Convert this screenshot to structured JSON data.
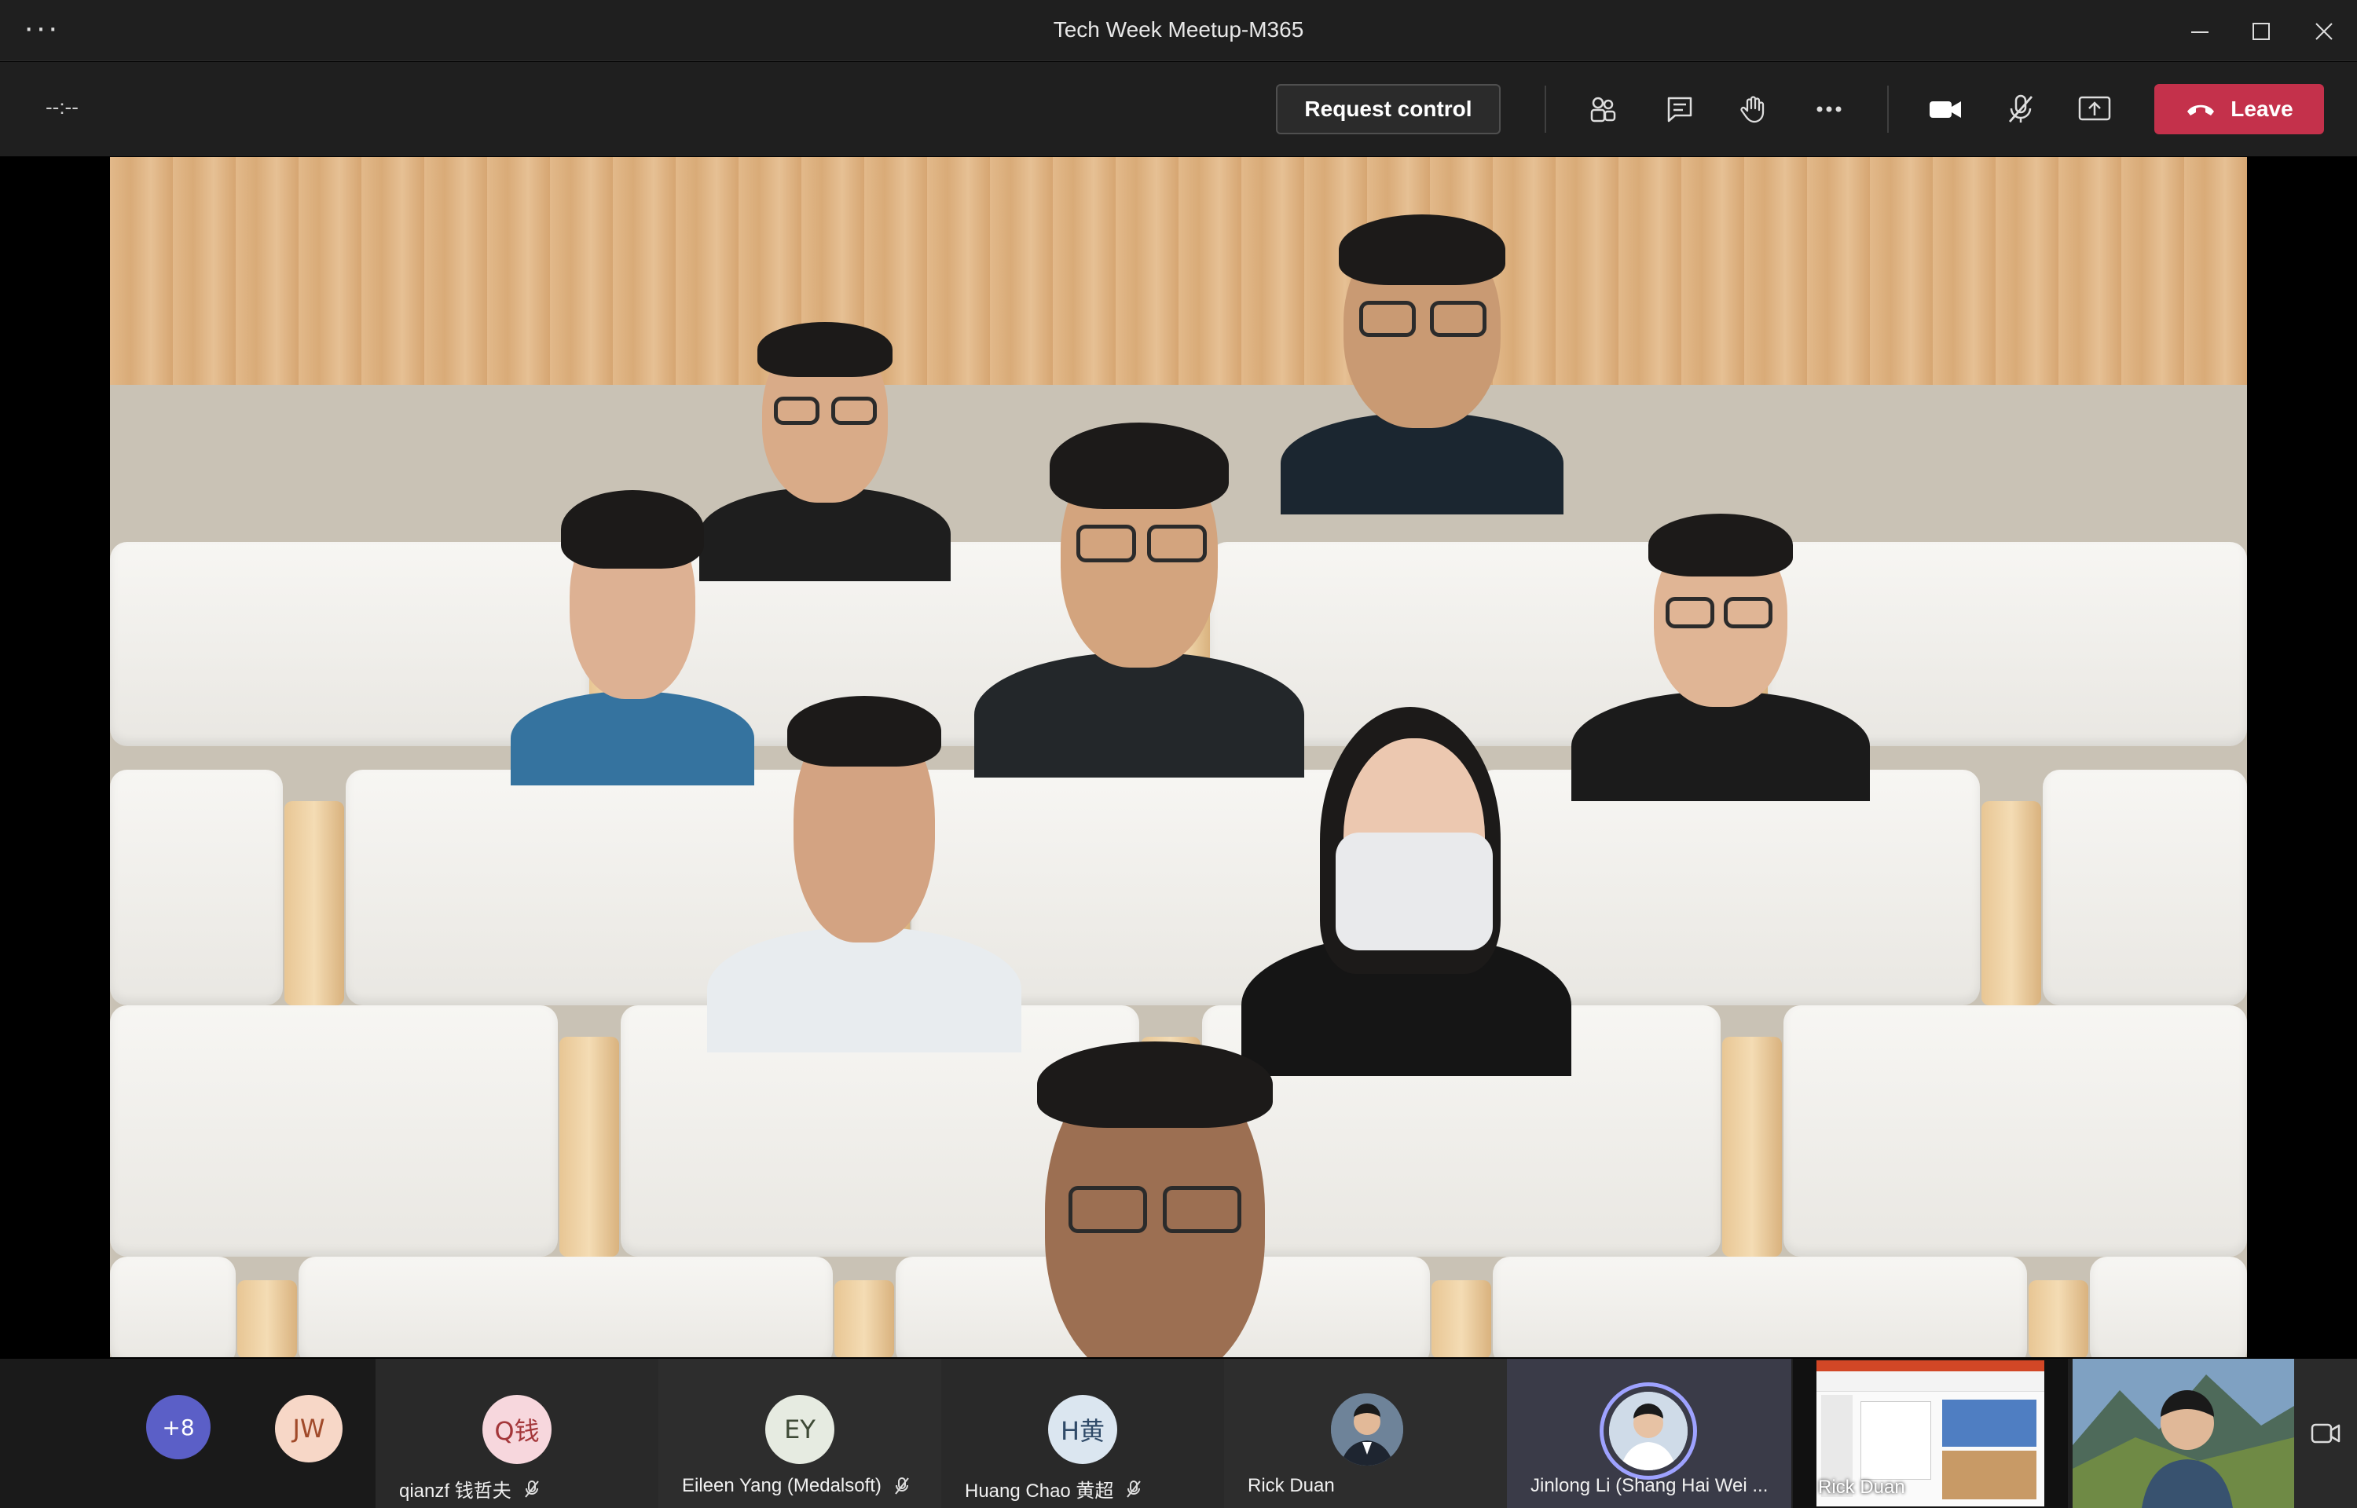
{
  "window": {
    "title": "Tech Week Meetup-M365",
    "menu_icon": "more-horizontal-icon",
    "controls": [
      "minimize-icon",
      "maximize-icon",
      "close-icon"
    ]
  },
  "toolbar": {
    "timer": "--:--",
    "request_control_label": "Request control",
    "icons": [
      "people-icon",
      "chat-icon",
      "raise-hand-icon",
      "more-icon",
      "camera-icon",
      "mic-off-icon",
      "share-screen-icon"
    ],
    "leave_label": "Leave",
    "leave_color": "#c4314b"
  },
  "stage": {
    "mode": "Together mode",
    "participants_visible": 9
  },
  "strip": {
    "overflow_badge": "+8",
    "participants": [
      {
        "initials": "JW",
        "name": "",
        "avatar_color": "#f7d7c7",
        "text_color": "#a14a2a"
      },
      {
        "initials": "Q钱",
        "name": "qianzf 钱哲夫",
        "muted": true,
        "avatar_color": "#f7d7dd",
        "text_color": "#a4373a"
      },
      {
        "initials": "EY",
        "name": "Eileen Yang (Medalsoft)",
        "muted": true,
        "avatar_color": "#e6ebe1",
        "text_color": "#3e4a36"
      },
      {
        "initials": "H黄",
        "name": "Huang Chao 黄超",
        "muted": true,
        "avatar_color": "#dbe6f0",
        "text_color": "#2f4a68"
      },
      {
        "initials": "",
        "name": "Rick Duan",
        "muted": false,
        "avatar_color": "#5b6f86"
      },
      {
        "initials": "",
        "name": "Jinlong Li (Shang Hai Wei ...",
        "muted": false,
        "speaking": true,
        "avatar_color": "#c9d6e6"
      }
    ],
    "shared_content_name": "Rick Duan",
    "self_view_icon": "camera-switch-icon"
  }
}
